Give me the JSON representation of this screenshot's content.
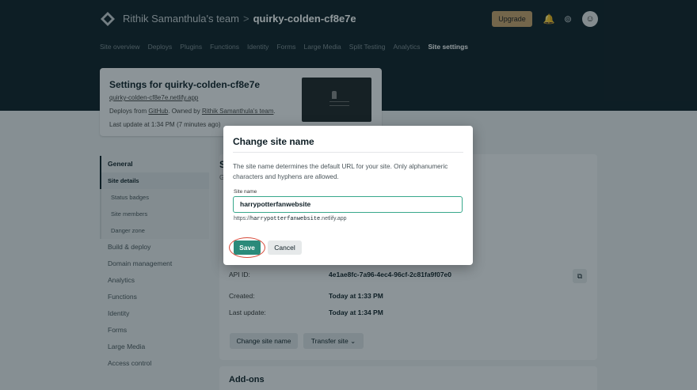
{
  "header": {
    "team": "Rithik Samanthula's team",
    "separator": ">",
    "site": "quirky-colden-cf8e7e",
    "upgrade_label": "Upgrade",
    "accent": "#c7a06a"
  },
  "nav": {
    "items": [
      {
        "label": "Site overview"
      },
      {
        "label": "Deploys"
      },
      {
        "label": "Plugins"
      },
      {
        "label": "Functions"
      },
      {
        "label": "Identity"
      },
      {
        "label": "Forms"
      },
      {
        "label": "Large Media"
      },
      {
        "label": "Split Testing"
      },
      {
        "label": "Analytics"
      },
      {
        "label": "Site settings"
      }
    ]
  },
  "site_card": {
    "title": "Settings for quirky-colden-cf8e7e",
    "url": "quirky-colden-cf8e7e.netlify.app",
    "deploys_prefix": "Deploys from ",
    "deploys_source": "GitHub",
    "owned_prefix": ". Owned by ",
    "owner": "Rithik Samanthula's team",
    "owned_suffix": ".",
    "last_update": "Last update at 1:34 PM (7 minutes ago)"
  },
  "sidebar": {
    "general": "General",
    "sub": [
      {
        "label": "Site details"
      },
      {
        "label": "Status badges"
      },
      {
        "label": "Site members"
      },
      {
        "label": "Danger zone"
      }
    ],
    "items": [
      {
        "label": "Build & deploy"
      },
      {
        "label": "Domain management"
      },
      {
        "label": "Analytics"
      },
      {
        "label": "Functions"
      },
      {
        "label": "Identity"
      },
      {
        "label": "Forms"
      },
      {
        "label": "Large Media"
      },
      {
        "label": "Access control"
      }
    ]
  },
  "panel": {
    "heading": "S",
    "sub": "G",
    "rows": [
      {
        "label": "API ID:",
        "value": "4e1ae8fc-7a96-4ec4-96cf-2c81fa9f07e0"
      },
      {
        "label": "Created:",
        "value": "Today at 1:33 PM"
      },
      {
        "label": "Last update:",
        "value": "Today at 1:34 PM"
      }
    ],
    "change_name_label": "Change site name",
    "transfer_label": "Transfer site ⌄",
    "addons_title": "Add-ons"
  },
  "modal": {
    "title": "Change site name",
    "description": "The site name determines the default URL for your site. Only alphanumeric characters and hyphens are allowed.",
    "field_label": "Site name",
    "field_value": "harrypotterfanwebsite",
    "url_prefix": "https://",
    "url_name": "harrypotterfanwebsite",
    "url_suffix": ".netlify.app",
    "save_label": "Save",
    "cancel_label": "Cancel",
    "save_color": "#2b8a7a",
    "input_border": "#38a88c"
  }
}
